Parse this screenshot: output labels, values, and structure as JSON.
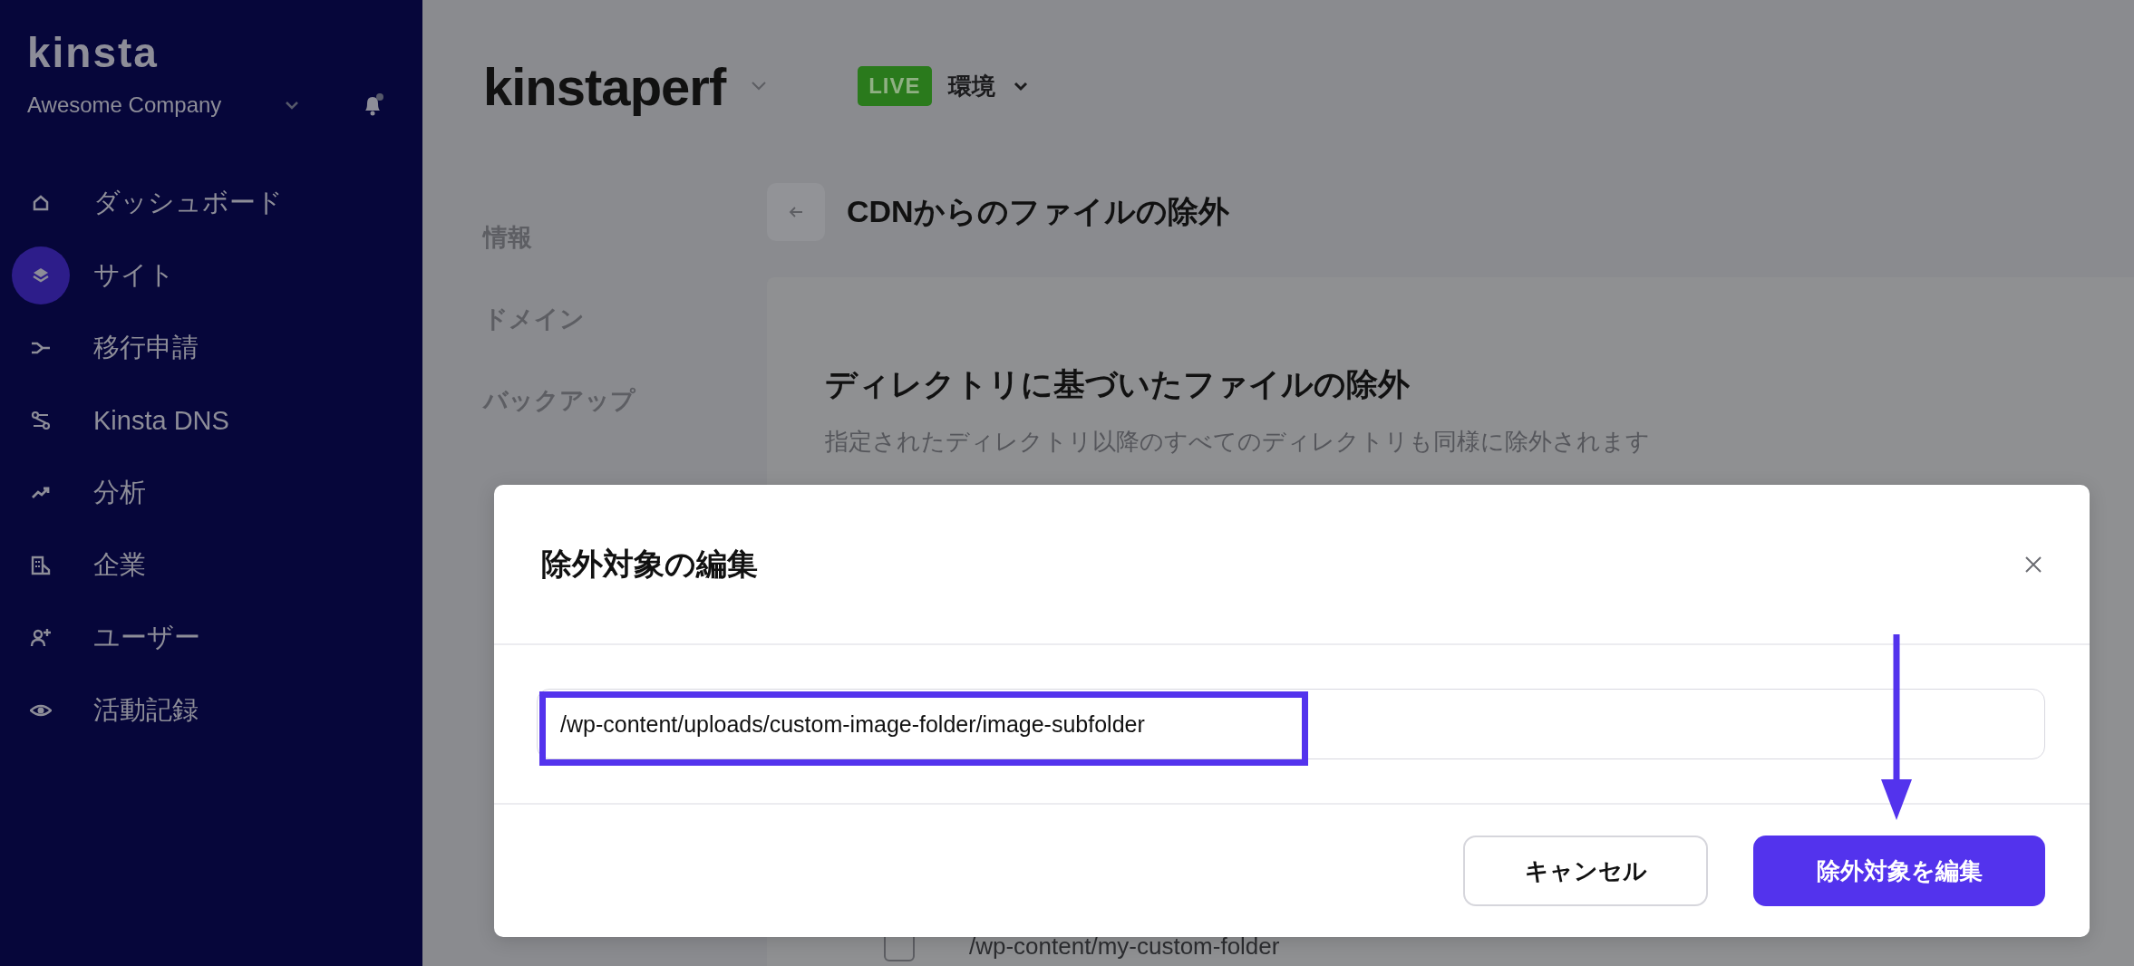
{
  "sidebar": {
    "logo": "kinsta",
    "company": "Awesome Company",
    "items": [
      {
        "label": "ダッシュボード",
        "selected": false
      },
      {
        "label": "サイト",
        "selected": true
      },
      {
        "label": "移行申請",
        "selected": false
      },
      {
        "label": "Kinsta DNS",
        "selected": false
      },
      {
        "label": "分析",
        "selected": false
      },
      {
        "label": "企業",
        "selected": false
      },
      {
        "label": "ユーザー",
        "selected": false
      },
      {
        "label": "活動記録",
        "selected": false
      }
    ]
  },
  "header": {
    "site_name": "kinstaperf",
    "environment_badge": "LIVE",
    "environment": "環境"
  },
  "site_menu": [
    {
      "label": "情報",
      "selected": false
    },
    {
      "label": "ドメイン",
      "selected": false
    },
    {
      "label": "バックアップ",
      "selected": false
    }
  ],
  "page": {
    "title": "CDNからのファイルの除外",
    "section_title": "ディレクトリに基づいたファイルの除外",
    "section_description": "指定されたディレクトリ以降のすべてのディレクトリも同様に除外されます",
    "exclusions": [
      {
        "path": "/wp-content/my-custom-folder",
        "checked": false
      }
    ]
  },
  "modal": {
    "title": "除外対象の編集",
    "value": "/wp-content/uploads/custom-image-folder/image-subfolder",
    "cancel": "キャンセル",
    "confirm": "除外対象を編集"
  }
}
